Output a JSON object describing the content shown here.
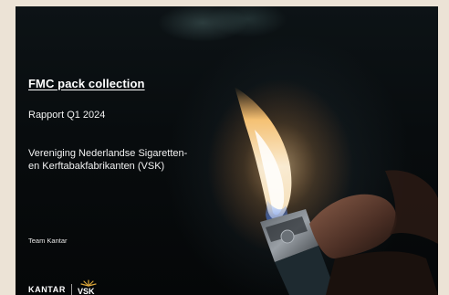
{
  "slide": {
    "title": "FMC pack collection",
    "subtitle": "Rapport Q1 2024",
    "organization_line1": "Vereniging Nederlandse Sigaretten-",
    "organization_line2": "en Kerftabakfabrikanten (VSK)",
    "team": "Team Kantar"
  },
  "logos": {
    "kantar": "KANTAR",
    "vsk": "VSK"
  },
  "background": {
    "image": "lighter-flame-in-hand",
    "colors": {
      "background_dark": "#080c0e",
      "frame": "#ece3d6",
      "text": "#ffffff",
      "flame_core": "#fff4dc",
      "flame_orange": "#f29a3a",
      "flame_blue": "#3b6fd8",
      "vsk_gold": "#d9a53a"
    }
  }
}
